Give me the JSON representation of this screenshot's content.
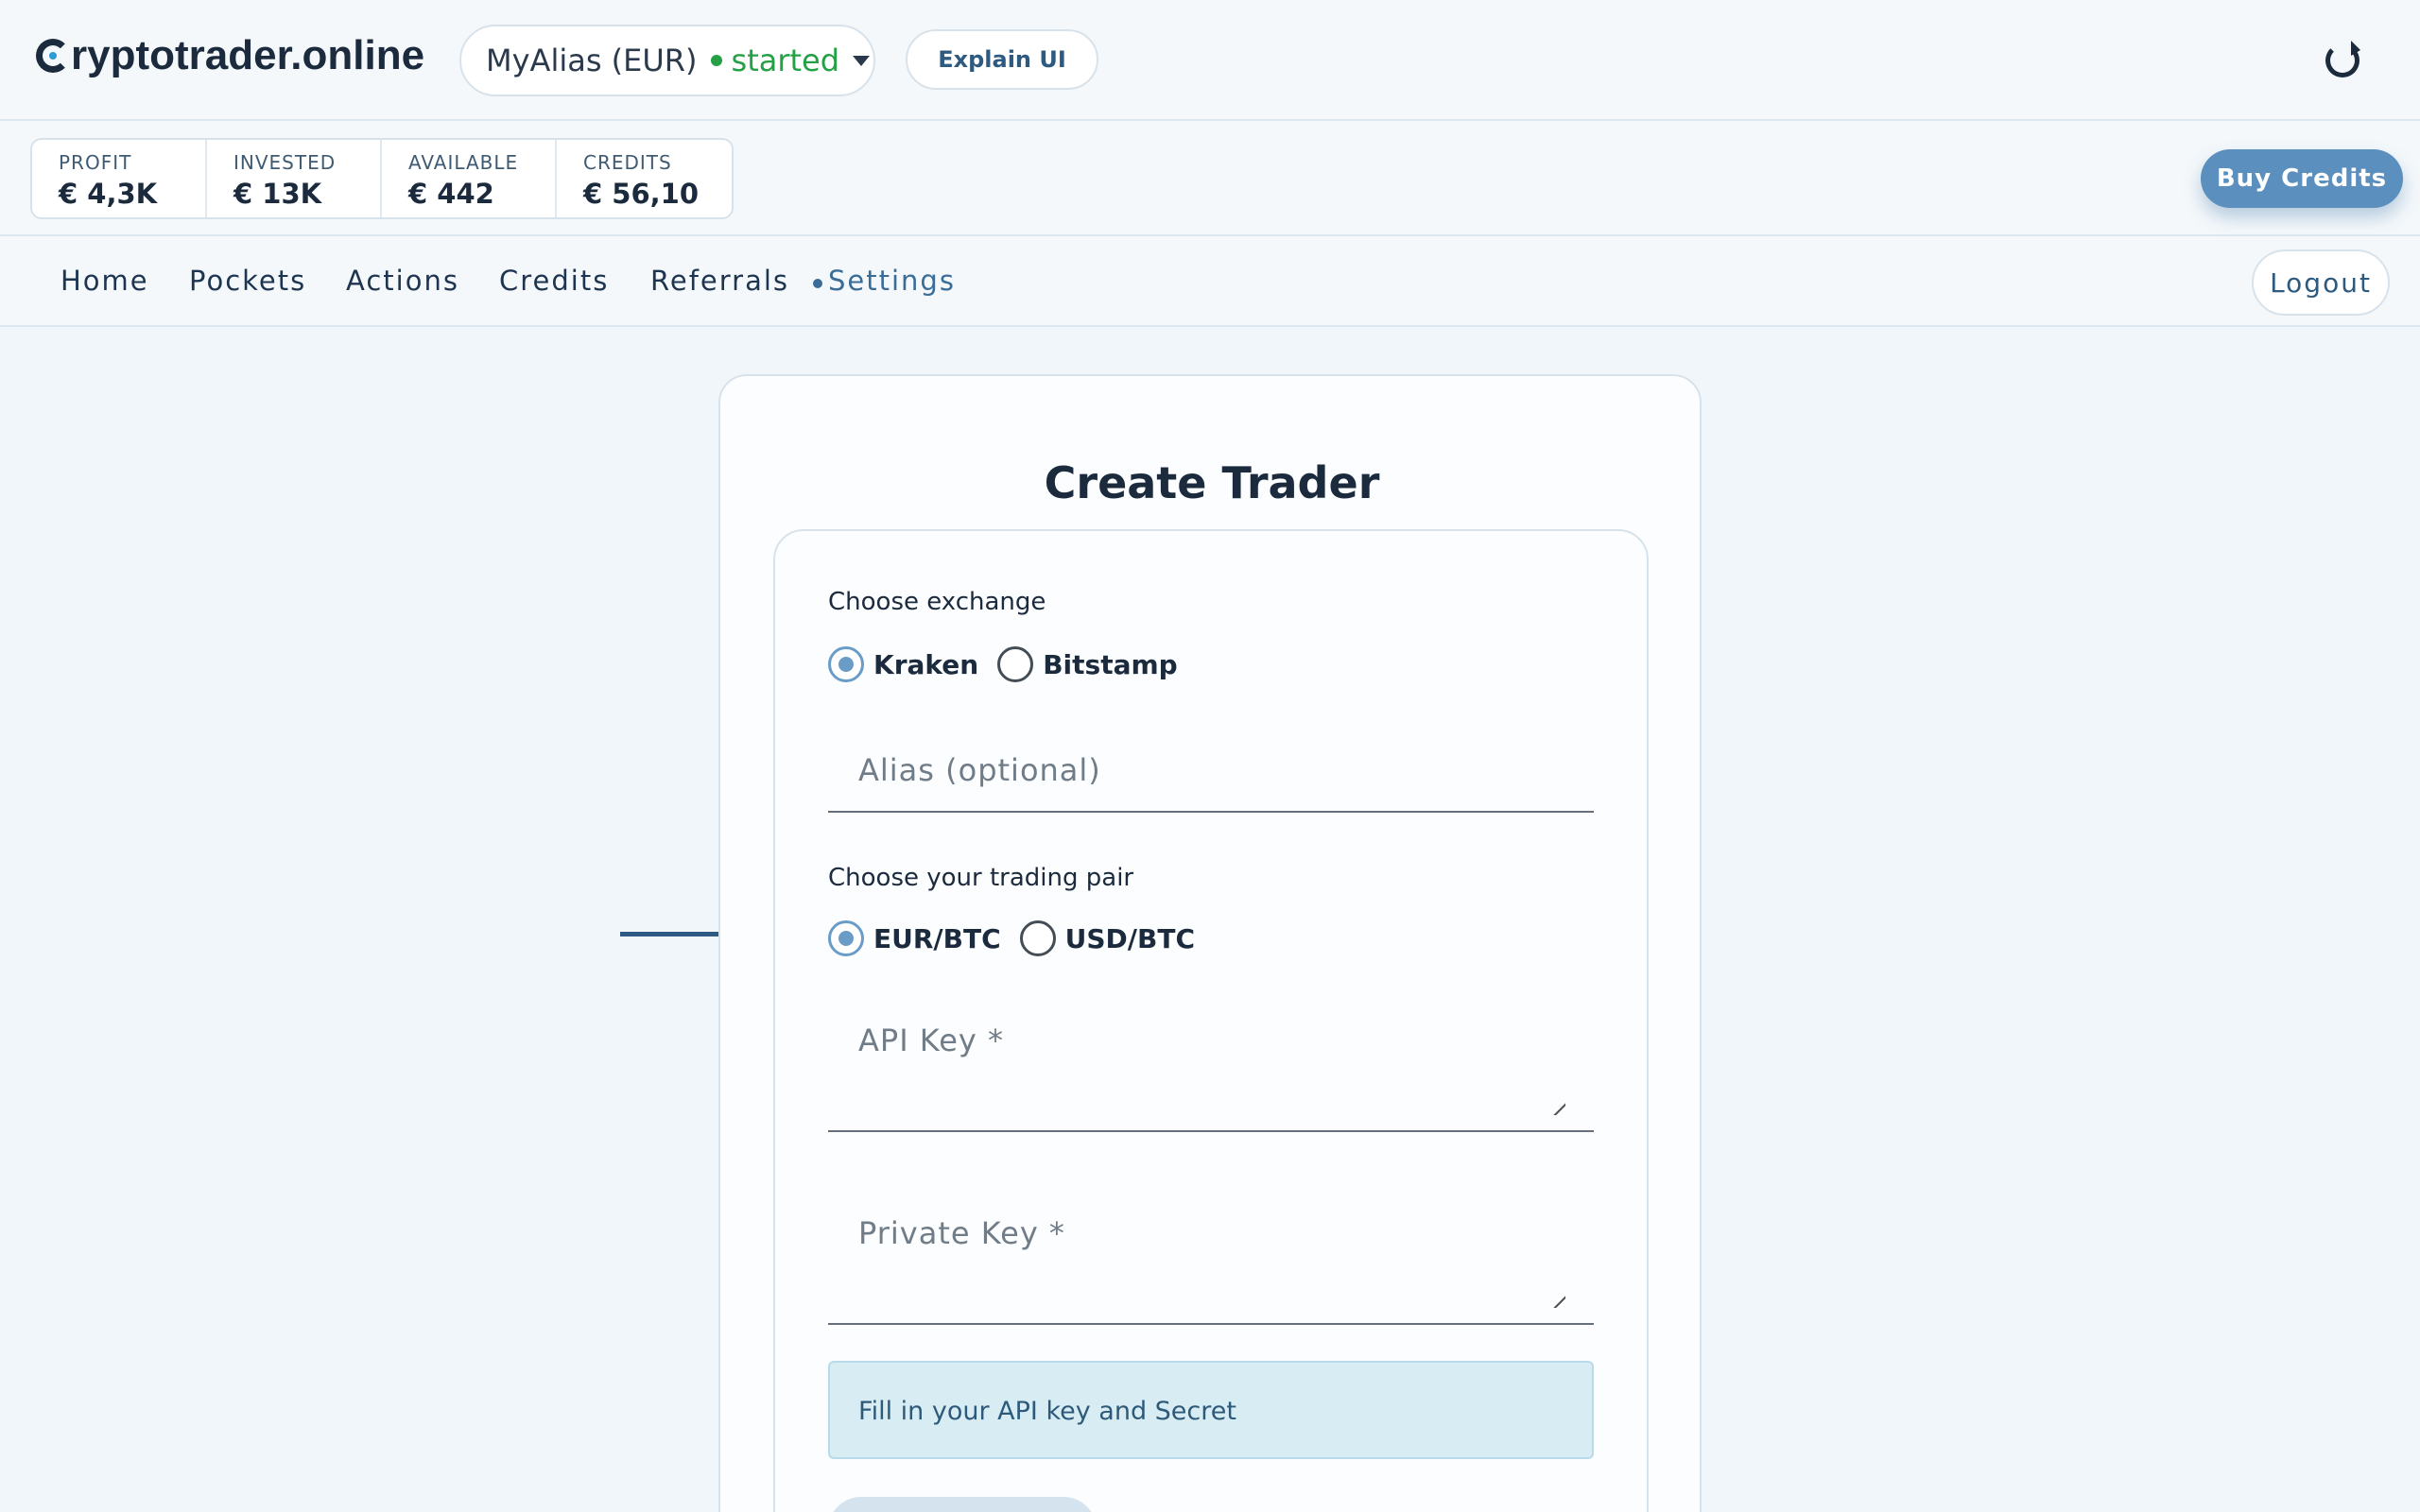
{
  "header": {
    "brand": "ryptotrader.online",
    "trader_select": {
      "alias": "MyAlias (EUR)",
      "status": "started"
    },
    "explain_label": "Explain UI"
  },
  "stats": [
    {
      "label": "PROFIT",
      "value": "€ 4,3K"
    },
    {
      "label": "INVESTED",
      "value": "€ 13K"
    },
    {
      "label": "AVAILABLE",
      "value": "€ 442"
    },
    {
      "label": "CREDITS",
      "value": "€ 56,10"
    }
  ],
  "buy_credits_label": "Buy Credits",
  "nav": {
    "items": [
      "Home",
      "Pockets",
      "Actions",
      "Credits",
      "Referrals",
      "Settings"
    ],
    "active": "Settings",
    "logout_label": "Logout"
  },
  "form": {
    "title": "Create Trader",
    "exchange_label": "Choose exchange",
    "exchanges": [
      {
        "label": "Kraken",
        "selected": true
      },
      {
        "label": "Bitstamp",
        "selected": false
      }
    ],
    "alias_placeholder": "Alias (optional)",
    "pair_label": "Choose your trading pair",
    "pairs": [
      {
        "label": "EUR/BTC",
        "selected": true
      },
      {
        "label": "USD/BTC",
        "selected": false
      }
    ],
    "api_key_placeholder": "API Key *",
    "private_key_placeholder": "Private Key *",
    "info_text": "Fill in your API key and Secret"
  },
  "colors": {
    "accent": "#3a6c98",
    "status_green": "#26a046",
    "highlight": "#2d5a82",
    "info_bg": "#d8ecf4"
  }
}
